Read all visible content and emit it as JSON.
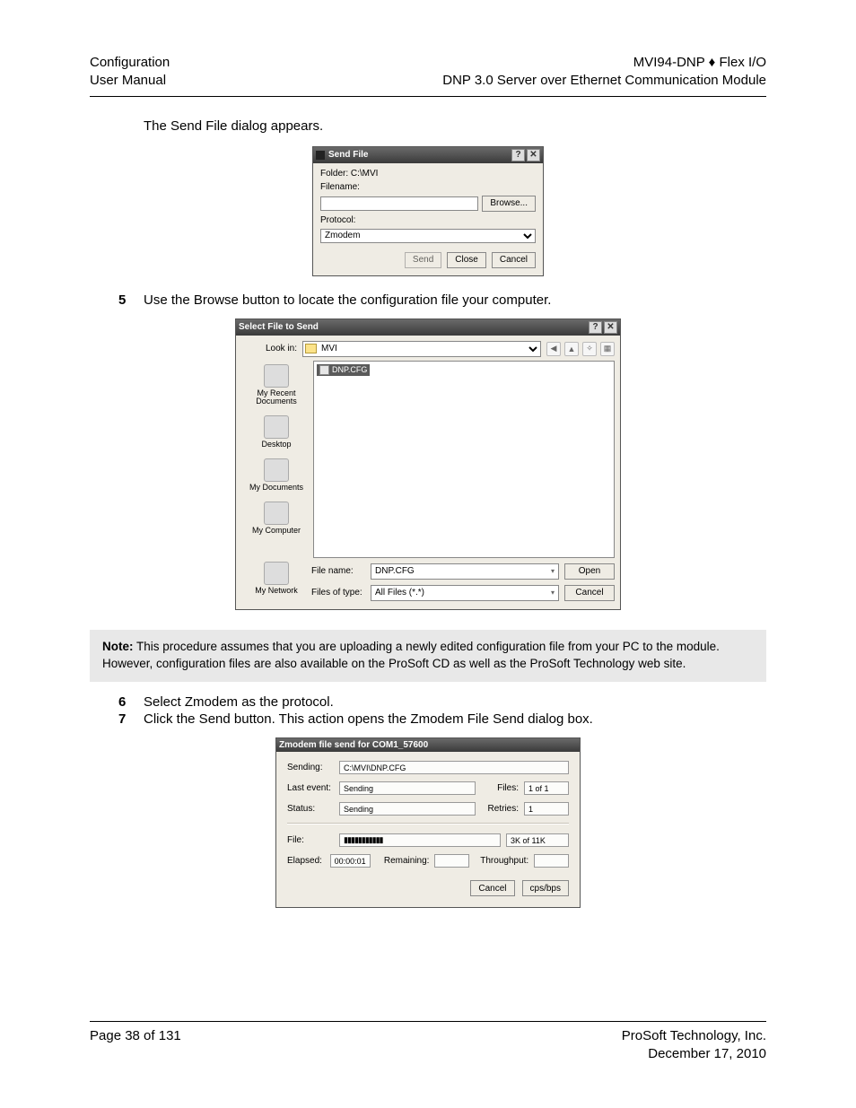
{
  "header": {
    "left": {
      "line1": "Configuration",
      "line2": "User Manual"
    },
    "right": {
      "line1": "MVI94-DNP ♦ Flex I/O",
      "line2": "DNP 3.0 Server over Ethernet Communication Module"
    }
  },
  "intro": "The Send File dialog appears.",
  "steps": {
    "s5": {
      "num": "5",
      "text": "Use the Browse button to locate the configuration file your computer."
    },
    "s6": {
      "num": "6",
      "text": "Select Zmodem as the protocol."
    },
    "s7": {
      "num": "7",
      "text": "Click the Send button. This action opens the Zmodem File Send dialog box."
    }
  },
  "note": {
    "label": "Note:",
    "text": " This procedure assumes that you are uploading a newly edited configuration file from your PC to the module. However, configuration files are also available on the ProSoft CD as well as the ProSoft Technology web site."
  },
  "dlg_send": {
    "title": "Send File",
    "folder_label": "Folder:",
    "folder_value": "C:\\MVI",
    "filename_label": "Filename:",
    "filename_value": "",
    "browse": "Browse...",
    "protocol_label": "Protocol:",
    "protocol_value": "Zmodem",
    "btn_send": "Send",
    "btn_close": "Close",
    "btn_cancel": "Cancel"
  },
  "dlg_select": {
    "title": "Select File to Send",
    "lookin_label": "Look in:",
    "lookin_value": "MVI",
    "sidebar": {
      "recent": "My Recent\nDocuments",
      "desktop": "Desktop",
      "mydocs": "My Documents",
      "mycomp": "My Computer",
      "mynet": "My Network"
    },
    "file_item": "DNP.CFG",
    "filename_label": "File name:",
    "filename_value": "DNP.CFG",
    "filetype_label": "Files of type:",
    "filetype_value": "All Files (*.*)",
    "btn_open": "Open",
    "btn_cancel": "Cancel"
  },
  "dlg_z": {
    "title": "Zmodem file send for COM1_57600",
    "sending_label": "Sending:",
    "sending_value": "C:\\MVI\\DNP.CFG",
    "lastevent_label": "Last event:",
    "lastevent_value": "Sending",
    "files_label": "Files:",
    "files_value": "1 of 1",
    "status_label": "Status:",
    "status_value": "Sending",
    "retries_label": "Retries:",
    "retries_value": "1",
    "file_label": "File:",
    "file_progress": "▮▮▮▮▮▮▮▮▮▮▮",
    "file_size": "3K of 11K",
    "elapsed_label": "Elapsed:",
    "elapsed_value": "00:00:01",
    "remaining_label": "Remaining:",
    "remaining_value": "",
    "throughput_label": "Throughput:",
    "throughput_value": "",
    "btn_cancel": "Cancel",
    "btn_cps": "cps/bps"
  },
  "footer": {
    "left": "Page 38 of 131",
    "right": {
      "line1": "ProSoft Technology, Inc.",
      "line2": "December 17, 2010"
    }
  }
}
